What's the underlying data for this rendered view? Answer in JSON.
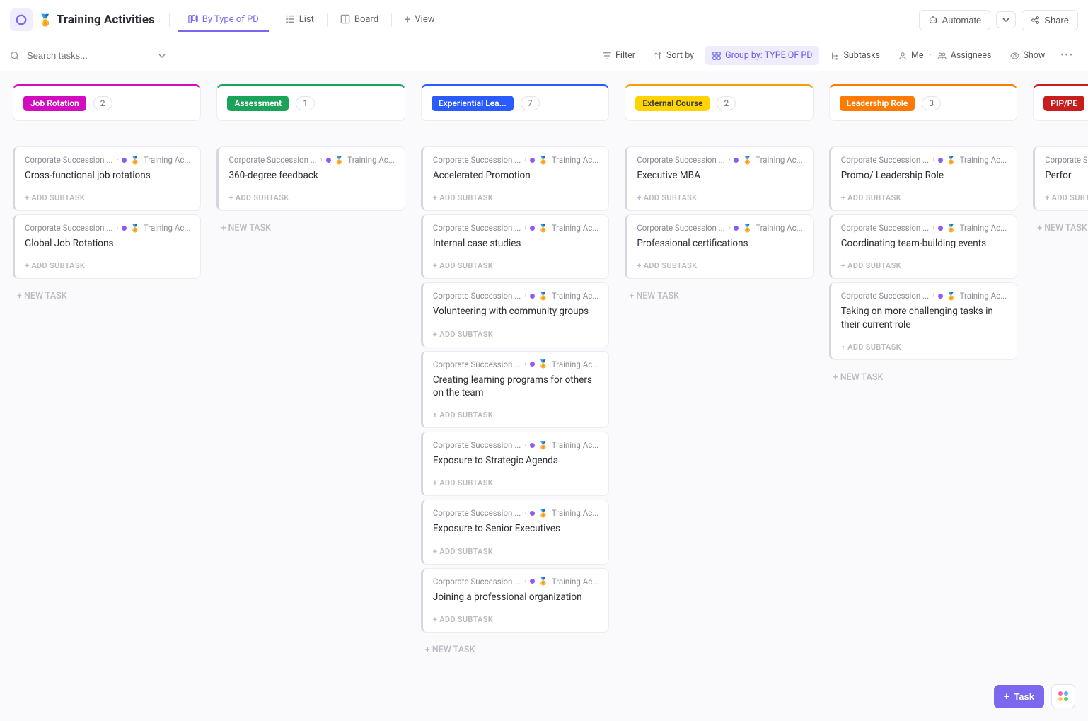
{
  "header": {
    "page_title": "Training Activities",
    "tabs": [
      {
        "label": "By Type of PD",
        "active": true
      },
      {
        "label": "List",
        "active": false
      },
      {
        "label": "Board",
        "active": false
      },
      {
        "label": "View",
        "active": false
      }
    ],
    "automate_label": "Automate",
    "share_label": "Share"
  },
  "toolbar": {
    "search_placeholder": "Search tasks...",
    "filter_label": "Filter",
    "sort_label": "Sort by",
    "group_label": "Group by: TYPE OF PD",
    "subtasks_label": "Subtasks",
    "me_label": "Me",
    "assignees_label": "Assignees",
    "show_label": "Show"
  },
  "breadcrumb": {
    "parent": "Corporate Succession ...",
    "list": "Training Ac..."
  },
  "card_actions": {
    "add_subtask": "+ ADD SUBTASK",
    "new_task": "+ NEW TASK"
  },
  "columns": [
    {
      "id": "job-rotation",
      "label": "Job Rotation",
      "count": "2",
      "topColor": "#d40cc0",
      "pillBg": "#d40cc0",
      "cards": [
        {
          "title": "Cross-functional job rotations"
        },
        {
          "title": "Global Job Rotations"
        }
      ]
    },
    {
      "id": "assessment",
      "label": "Assessment",
      "count": "1",
      "topColor": "#1ba35a",
      "pillBg": "#1ba35a",
      "cards": [
        {
          "title": "360-degree feedback"
        }
      ]
    },
    {
      "id": "experiential",
      "label": "Experiential Lea...",
      "count": "7",
      "topColor": "#2a5bff",
      "pillBg": "#2a5bff",
      "cards": [
        {
          "title": "Accelerated Promotion"
        },
        {
          "title": "Internal case studies"
        },
        {
          "title": "Volunteering with community groups"
        },
        {
          "title": "Creating learning programs for others on the team"
        },
        {
          "title": "Exposure to Strategic Agenda"
        },
        {
          "title": "Exposure to Senior Executives"
        },
        {
          "title": "Joining a professional organization"
        }
      ]
    },
    {
      "id": "external-course",
      "label": "External Course",
      "count": "2",
      "topColor": "#f59e0b",
      "pillBg": "#ffd400",
      "pillText": "#3a3a3a",
      "cards": [
        {
          "title": "Executive MBA"
        },
        {
          "title": "Professional certifications"
        }
      ]
    },
    {
      "id": "leadership-role",
      "label": "Leadership Role",
      "count": "3",
      "topColor": "#ff7a00",
      "pillBg": "#ff7a00",
      "cards": [
        {
          "title": "Promo/ Leadership Role"
        },
        {
          "title": "Coordinating team-building events"
        },
        {
          "title": "Taking on more challenging tasks in their current role"
        }
      ]
    },
    {
      "id": "pip",
      "label": "PIP/PE",
      "count": "",
      "topColor": "#c81e1e",
      "pillBg": "#c81e1e",
      "cards": [
        {
          "title": "Perfor"
        }
      ]
    }
  ],
  "fab": {
    "task_label": "Task"
  }
}
